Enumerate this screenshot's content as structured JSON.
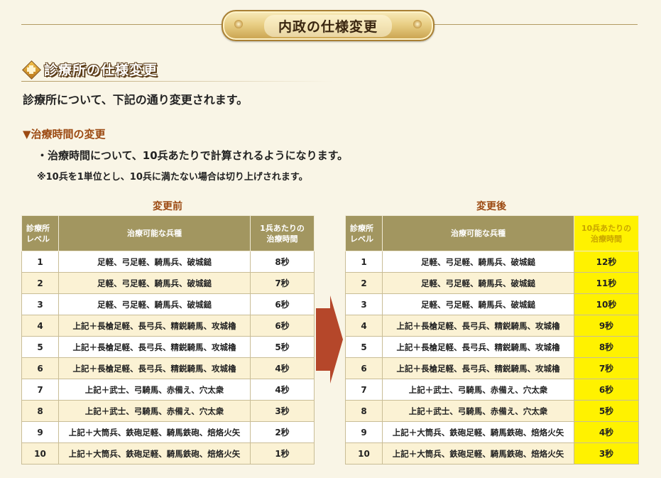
{
  "header": {
    "banner_title": "内政の仕様変更"
  },
  "section": {
    "title": "診療所の仕様変更",
    "intro": "診療所について、下記の通り変更されます。",
    "sub_heading": "▼治療時間の変更",
    "bullet": "・治療時間について、10兵あたりで計算されるようになります。",
    "note": "※10兵を1単位とし、10兵に満たない場合は切り上げされます。"
  },
  "before": {
    "title": "変更前",
    "headers": {
      "level": [
        "診療所",
        "レベル"
      ],
      "units": "治療可能な兵種",
      "time": [
        "1兵あたりの",
        "治療時間"
      ]
    },
    "rows": [
      {
        "level": "1",
        "units": "足軽、弓足軽、騎馬兵、破城鎚",
        "time": "8秒"
      },
      {
        "level": "2",
        "units": "足軽、弓足軽、騎馬兵、破城鎚",
        "time": "7秒"
      },
      {
        "level": "3",
        "units": "足軽、弓足軽、騎馬兵、破城鎚",
        "time": "6秒"
      },
      {
        "level": "4",
        "units": "上記＋長槍足軽、長弓兵、精鋭騎馬、攻城櫓",
        "time": "6秒"
      },
      {
        "level": "5",
        "units": "上記＋長槍足軽、長弓兵、精鋭騎馬、攻城櫓",
        "time": "5秒"
      },
      {
        "level": "6",
        "units": "上記＋長槍足軽、長弓兵、精鋭騎馬、攻城櫓",
        "time": "4秒"
      },
      {
        "level": "7",
        "units": "上記＋武士、弓騎馬、赤備え、穴太衆",
        "time": "4秒"
      },
      {
        "level": "8",
        "units": "上記＋武士、弓騎馬、赤備え、穴太衆",
        "time": "3秒"
      },
      {
        "level": "9",
        "units": "上記＋大筒兵、鉄砲足軽、騎馬鉄砲、焙烙火矢",
        "time": "2秒"
      },
      {
        "level": "10",
        "units": "上記＋大筒兵、鉄砲足軽、騎馬鉄砲、焙烙火矢",
        "time": "1秒"
      }
    ]
  },
  "after": {
    "title": "変更後",
    "headers": {
      "level": [
        "診療所",
        "レベル"
      ],
      "units": "治療可能な兵種",
      "time": [
        "10兵あたりの",
        "治療時間"
      ]
    },
    "rows": [
      {
        "level": "1",
        "units": "足軽、弓足軽、騎馬兵、破城鎚",
        "time": "12秒"
      },
      {
        "level": "2",
        "units": "足軽、弓足軽、騎馬兵、破城鎚",
        "time": "11秒"
      },
      {
        "level": "3",
        "units": "足軽、弓足軽、騎馬兵、破城鎚",
        "time": "10秒"
      },
      {
        "level": "4",
        "units": "上記＋長槍足軽、長弓兵、精鋭騎馬、攻城櫓",
        "time": "9秒"
      },
      {
        "level": "5",
        "units": "上記＋長槍足軽、長弓兵、精鋭騎馬、攻城櫓",
        "time": "8秒"
      },
      {
        "level": "6",
        "units": "上記＋長槍足軽、長弓兵、精鋭騎馬、攻城櫓",
        "time": "7秒"
      },
      {
        "level": "7",
        "units": "上記＋武士、弓騎馬、赤備え、穴太衆",
        "time": "6秒"
      },
      {
        "level": "8",
        "units": "上記＋武士、弓騎馬、赤備え、穴太衆",
        "time": "5秒"
      },
      {
        "level": "9",
        "units": "上記＋大筒兵、鉄砲足軽、騎馬鉄砲、焙烙火矢",
        "time": "4秒"
      },
      {
        "level": "10",
        "units": "上記＋大筒兵、鉄砲足軽、騎馬鉄砲、焙烙火矢",
        "time": "3秒"
      }
    ]
  },
  "icons": {
    "section_icon": "medical-cross-icon",
    "arrow_icon": "arrow-right-icon"
  },
  "colors": {
    "header_bg": "#a29660",
    "highlight": "#fff200",
    "accent": "#9c4a12",
    "arrow": "#b5472a"
  }
}
